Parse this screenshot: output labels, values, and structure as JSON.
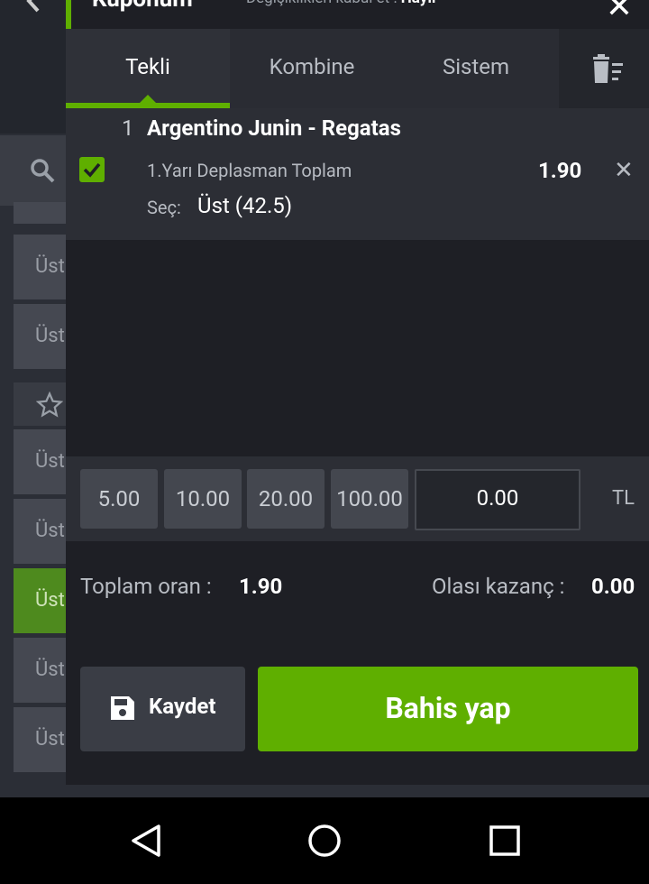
{
  "header": {
    "title": "Kuponum",
    "change_prefix": "Değişiklikleri kabul et :",
    "change_value": "Hayır"
  },
  "background": {
    "row_label": "Üst"
  },
  "tabs": [
    {
      "label": "Tekli",
      "active": true
    },
    {
      "label": "Kombine",
      "active": false
    },
    {
      "label": "Sistem",
      "active": false
    }
  ],
  "bet": {
    "index": "1",
    "match": "Argentino Junin - Regatas",
    "market": "1.Yarı Deplasman Toplam",
    "odd": "1.90",
    "selection_label": "Seç:",
    "selection": "Üst (42.5)"
  },
  "stake": {
    "chips": [
      "5.00",
      "10.00",
      "20.00",
      "100.00"
    ],
    "amount": "0.00",
    "currency": "TL"
  },
  "summary": {
    "total_odds_label": "Toplam oran :",
    "total_odds": "1.90",
    "potential_win_label": "Olası kazanç :",
    "potential_win": "0.00"
  },
  "actions": {
    "save_label": "Kaydet",
    "place_bet_label": "Bahis yap"
  },
  "colors": {
    "accent": "#5faf00",
    "panel": "#1e1f25",
    "card": "#2c2e35"
  }
}
